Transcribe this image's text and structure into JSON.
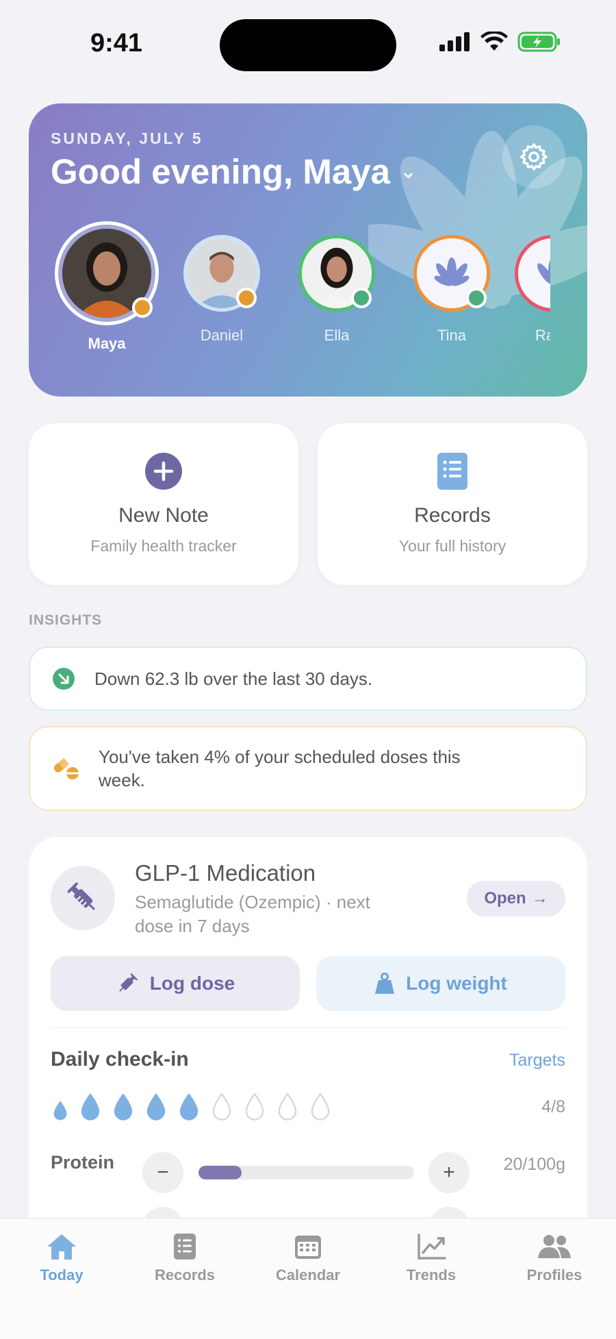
{
  "status_bar": {
    "time": "9:41"
  },
  "header": {
    "date": "SUNDAY, JULY 5",
    "greeting": "Good evening, Maya",
    "profiles": [
      {
        "name": "Maya",
        "active": true,
        "status_color": "#e39a2e"
      },
      {
        "name": "Daniel",
        "active": false,
        "status_color": "#e39a2e"
      },
      {
        "name": "Ella",
        "active": false,
        "status_color": "#4cad7c"
      },
      {
        "name": "Tina",
        "active": false,
        "status_color": "#4cad7c"
      },
      {
        "name": "Ra",
        "active": false,
        "status_color": "#e8546b"
      }
    ]
  },
  "actions": {
    "new_note": {
      "title": "New Note",
      "subtitle": "Family health tracker"
    },
    "records": {
      "title": "Records",
      "subtitle": "Your full history"
    }
  },
  "insights": {
    "label": "INSIGHTS",
    "weight": "Down 62.3 lb over the last 30 days.",
    "doses": "You've taken 4% of your scheduled doses this week."
  },
  "medication": {
    "title": "GLP-1 Medication",
    "subtitle": "Semaglutide (Ozempic) · next dose in 7 days",
    "open_label": "Open",
    "log_dose_label": "Log dose",
    "log_weight_label": "Log weight"
  },
  "checkin": {
    "title": "Daily check-in",
    "targets_label": "Targets",
    "water_filled": 5,
    "water_total": 8,
    "water_count": "4/8",
    "protein_label": "Protein",
    "protein_value": "20/100g",
    "protein_fraction": 0.2
  },
  "tabs": [
    {
      "label": "Today",
      "icon": "home-icon",
      "active": true
    },
    {
      "label": "Records",
      "icon": "records-icon",
      "active": false
    },
    {
      "label": "Calendar",
      "icon": "calendar-icon",
      "active": false
    },
    {
      "label": "Trends",
      "icon": "trends-icon",
      "active": false
    },
    {
      "label": "Profiles",
      "icon": "profiles-icon",
      "active": false
    }
  ],
  "colors": {
    "accent_purple": "#6d68a2",
    "accent_blue": "#6fa3d6",
    "insight_green": "#4cad7c",
    "insight_orange": "#e39a2e"
  }
}
